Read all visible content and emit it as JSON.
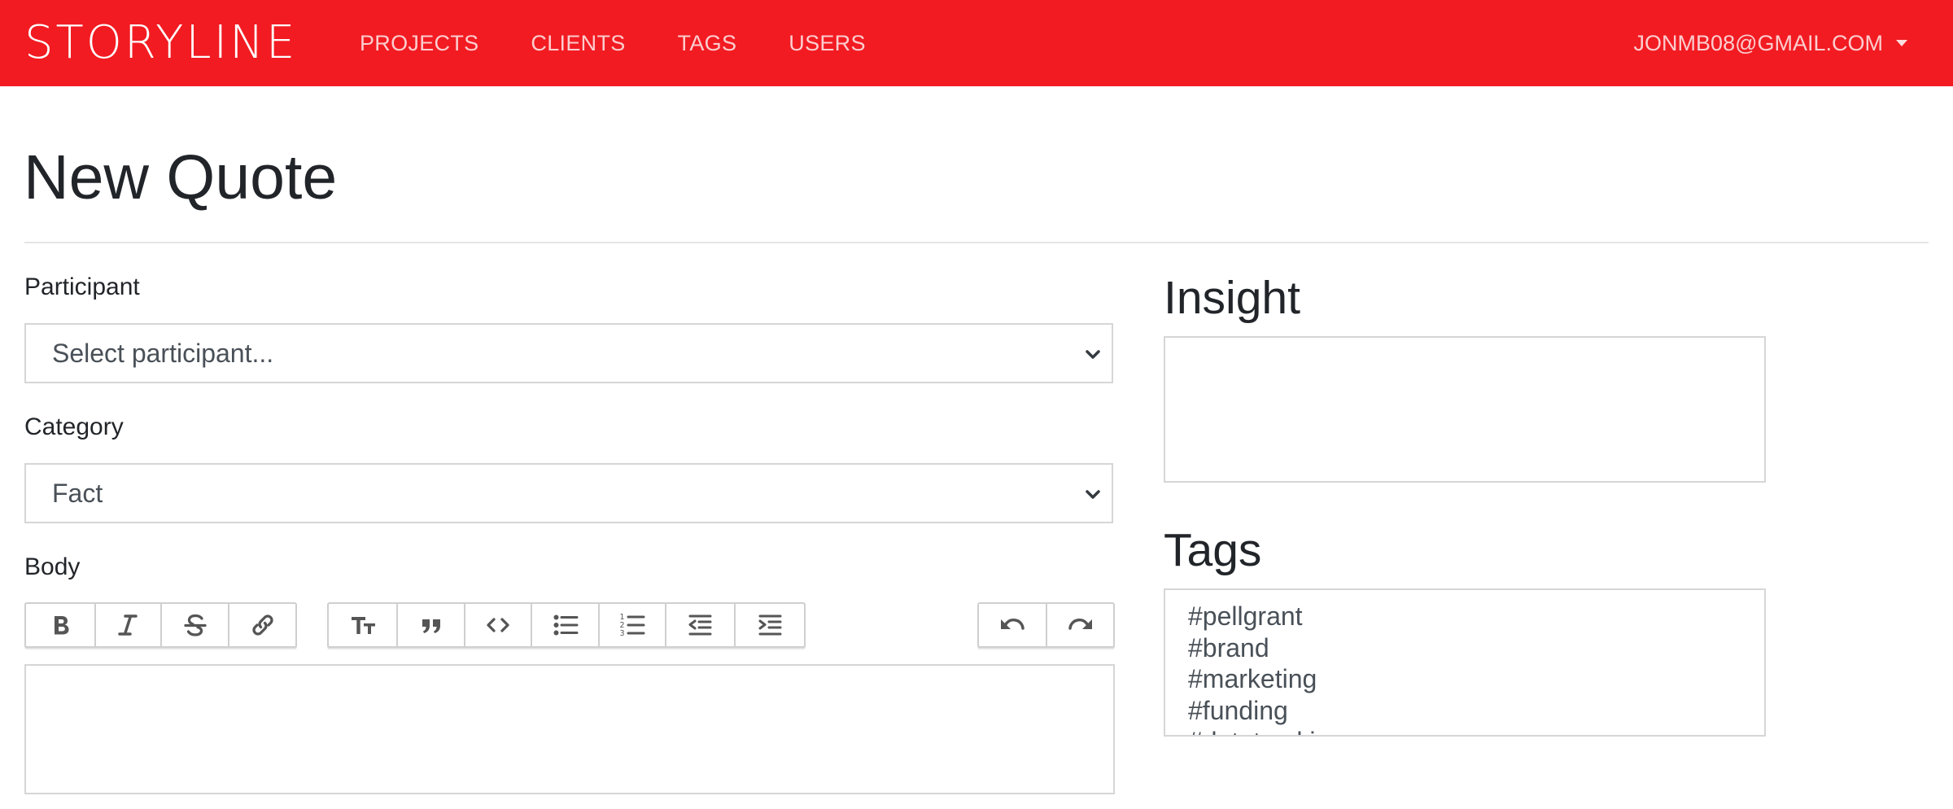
{
  "brand": "STORYLINE",
  "nav": {
    "links": [
      "PROJECTS",
      "CLIENTS",
      "TAGS",
      "USERS"
    ],
    "user_email": "JONMB08@GMAIL.COM"
  },
  "page_title": "New Quote",
  "form": {
    "participant": {
      "label": "Participant",
      "value": "Select participant..."
    },
    "category": {
      "label": "Category",
      "value": "Fact"
    },
    "body": {
      "label": "Body"
    }
  },
  "toolbar": {
    "formatting": [
      "bold-icon",
      "italic-icon",
      "strikethrough-icon",
      "link-icon"
    ],
    "blocks": [
      "heading-icon",
      "quote-icon",
      "code-icon",
      "bullet-list-icon",
      "numbered-list-icon",
      "outdent-icon",
      "indent-icon"
    ],
    "history": [
      "undo-icon",
      "redo-icon"
    ]
  },
  "insight": {
    "title": "Insight"
  },
  "tags": {
    "title": "Tags",
    "items": [
      "#pellgrant",
      "#brand",
      "#marketing",
      "#funding",
      "#datatracking"
    ]
  },
  "colors": {
    "accent": "#f21b22",
    "text": "#212529",
    "input_text": "#495057",
    "border": "#d6d6d6"
  }
}
